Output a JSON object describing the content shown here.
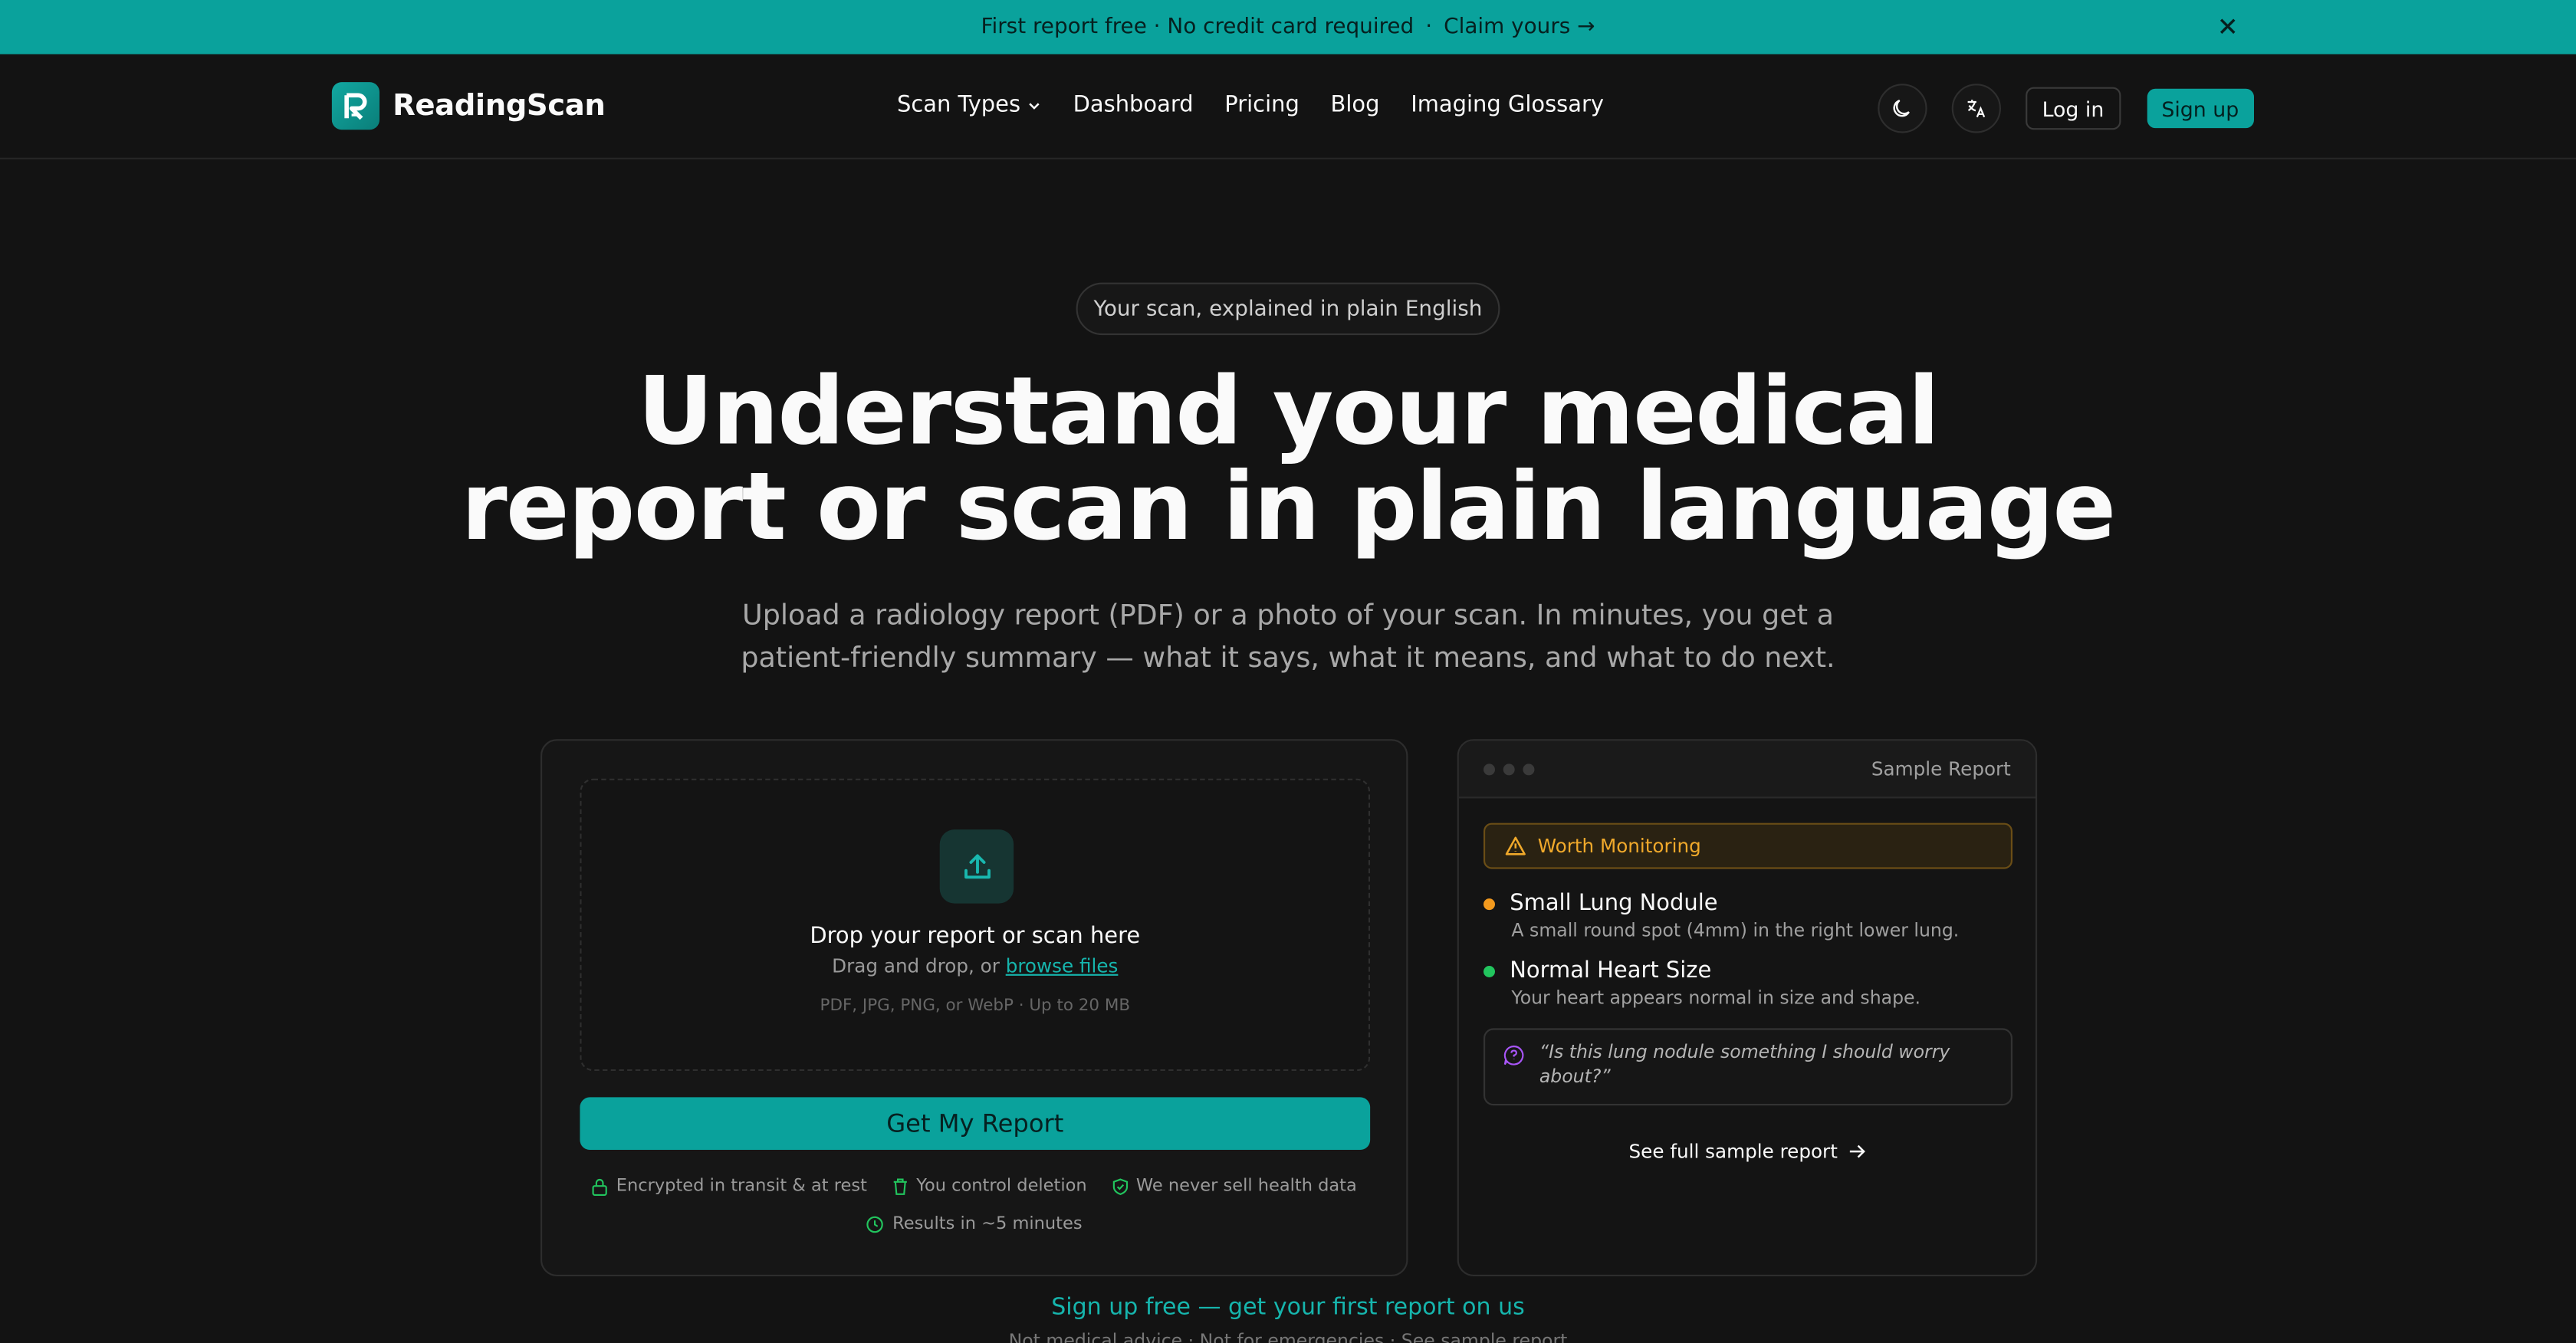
{
  "banner": {
    "text": "First report free · No credit card required",
    "separator": "·",
    "claim": "Claim yours →"
  },
  "nav": {
    "brand": "ReadingScan",
    "links": [
      "Scan Types",
      "Dashboard",
      "Pricing",
      "Blog",
      "Imaging Glossary"
    ],
    "login": "Log in",
    "signup": "Sign up"
  },
  "hero": {
    "pill": "Your scan, explained in plain English",
    "title_line1": "Understand your medical",
    "title_line2": "report or scan in plain language",
    "subtitle_line1": "Upload a radiology report (PDF) or a photo of your scan. In minutes, you get a",
    "subtitle_line2": "patient-friendly summary — what it says, what it means, and what to do next."
  },
  "upload": {
    "title": "Drop your report or scan here",
    "sub_prefix": "Drag and drop, or",
    "browse": "browse files",
    "hint": "PDF, JPG, PNG, or WebP · Up to 20 MB",
    "button": "Get My Report",
    "trust": [
      "Encrypted in transit & at rest",
      "You control deletion",
      "We never sell health data",
      "Results in ~5 minutes"
    ]
  },
  "sample": {
    "title": "Sample Report",
    "status": "Worth Monitoring",
    "findings": [
      {
        "title": "Small Lung Nodule",
        "desc": "A small round spot (4mm) in the right lower lung.",
        "color": "#f39a1e"
      },
      {
        "title": "Normal Heart Size",
        "desc": "Your heart appears normal in size and shape.",
        "color": "#22c55e"
      }
    ],
    "question_line1": "“Is this lung nodule something I should worry",
    "question_line2": "about?”",
    "see_full": "See full sample report"
  },
  "cta": "Sign up free — get your first report on us",
  "footnote": "Not medical advice · Not for emergencies · See sample report",
  "colors": {
    "accent": "#0aa29c",
    "background": "#131313",
    "warning": "#f0a92b"
  }
}
